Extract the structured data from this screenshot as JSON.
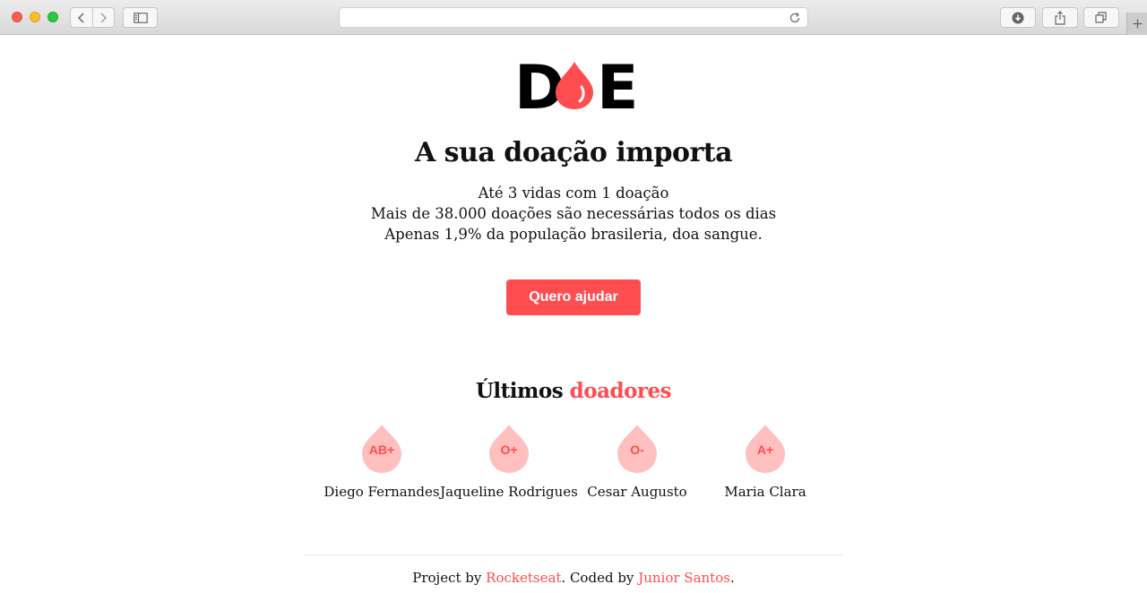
{
  "browser": {
    "address": "",
    "icons": {
      "back": "chevron-left-icon",
      "forward": "chevron-right-icon",
      "sidebar": "sidebar-icon",
      "reload": "reload-icon",
      "downloads": "download-icon",
      "share": "share-icon",
      "tabs": "tabs-icon",
      "new_tab": "plus-icon"
    }
  },
  "logo": {
    "alt": "DOE",
    "left_letter": "D",
    "right_letter": "E"
  },
  "hero": {
    "title": "A sua doação importa",
    "facts": [
      "Até 3 vidas com 1 doação",
      "Mais de 38.000 doações são necessárias todos os dias",
      "Apenas 1,9% da população brasileria, doa sangue."
    ],
    "cta_label": "Quero ajudar"
  },
  "donors_section": {
    "title_part1": "Últimos",
    "title_part2": "doadores",
    "donors": [
      {
        "blood": "AB+",
        "name": "Diego Fernandes"
      },
      {
        "blood": "O+",
        "name": "Jaqueline Rodrigues"
      },
      {
        "blood": "O-",
        "name": "Cesar Augusto"
      },
      {
        "blood": "A+",
        "name": "Maria Clara"
      }
    ]
  },
  "footer": {
    "prefix": "Project by",
    "author_link": "Rocketseat",
    "middle": ". Coded by",
    "coder_link": "Junior Santos",
    "suffix": "."
  },
  "colors": {
    "accent": "#ff4d50",
    "drop_light": "#ffbfbf",
    "text": "#111111"
  }
}
